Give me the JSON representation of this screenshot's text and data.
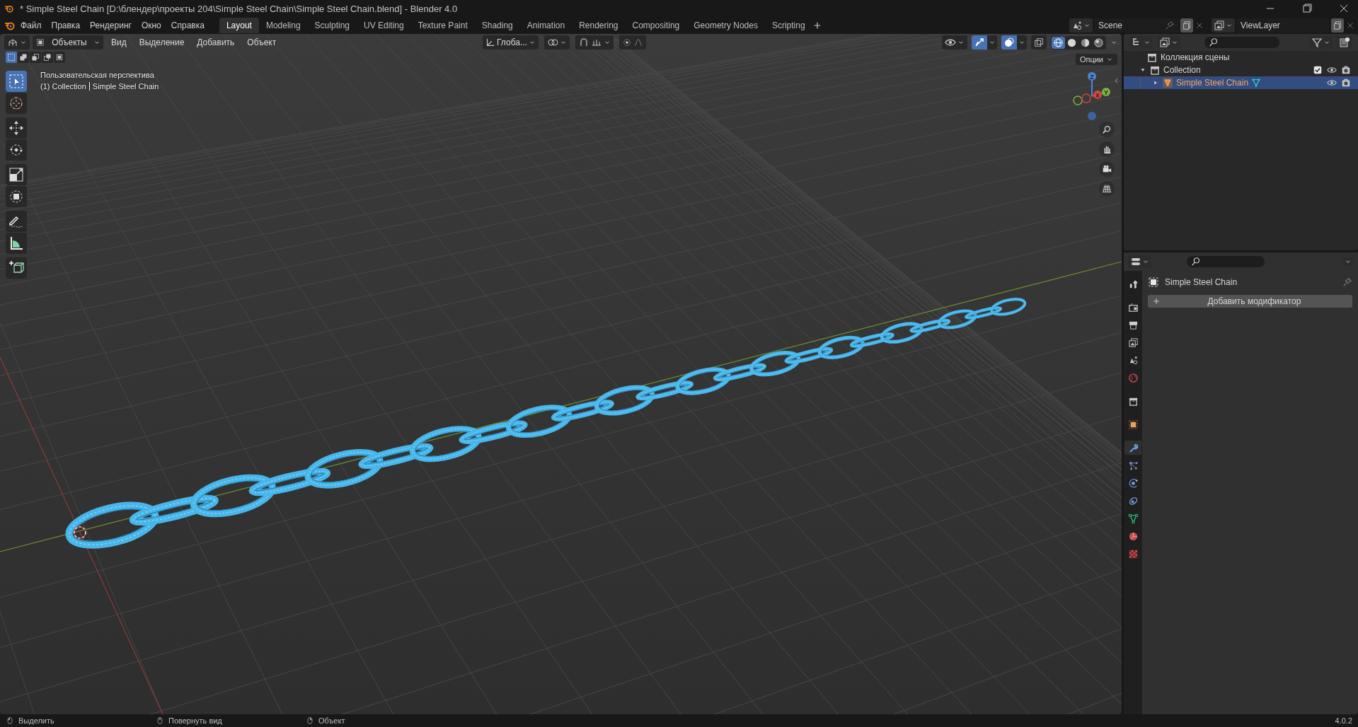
{
  "window": {
    "title": "* Simple Steel Chain [D:\\блендер\\проекты 204\\Simple Steel Chain\\Simple Steel Chain.blend] - Blender 4.0"
  },
  "menu": [
    "Файл",
    "Правка",
    "Рендеринг",
    "Окно",
    "Справка"
  ],
  "workspaces": [
    {
      "label": "Layout",
      "selected": true
    },
    {
      "label": "Modeling",
      "selected": false
    },
    {
      "label": "Sculpting",
      "selected": false
    },
    {
      "label": "UV Editing",
      "selected": false
    },
    {
      "label": "Texture Paint",
      "selected": false
    },
    {
      "label": "Shading",
      "selected": false
    },
    {
      "label": "Animation",
      "selected": false
    },
    {
      "label": "Rendering",
      "selected": false
    },
    {
      "label": "Compositing",
      "selected": false
    },
    {
      "label": "Geometry Nodes",
      "selected": false
    },
    {
      "label": "Scripting",
      "selected": false
    }
  ],
  "scene": {
    "value": "Scene"
  },
  "view_layer": {
    "value": "ViewLayer"
  },
  "viewport": {
    "mode": "Объекты",
    "menus": [
      "Вид",
      "Выделение",
      "Добавить",
      "Объект"
    ],
    "orientation": "Глоба...",
    "options": "Опции",
    "select_modes": [
      {
        "selected": true
      },
      {
        "selected": false
      },
      {
        "selected": false
      },
      {
        "selected": false
      },
      {
        "selected": false
      }
    ],
    "tools": [
      {
        "selected": true
      },
      {
        "selected": false
      },
      {
        "selected": false
      },
      {
        "selected": false
      },
      {
        "selected": false
      },
      {
        "selected": false
      },
      {
        "selected": false
      },
      {
        "selected": false
      },
      {
        "selected": false
      }
    ],
    "shading_modes": [
      {
        "selected": true
      },
      {
        "selected": false
      },
      {
        "selected": false
      },
      {
        "selected": false
      }
    ],
    "overlay_text": [
      "Пользовательская перспектива",
      "(1) Collection",
      "Simple Steel Chain"
    ],
    "gizmo_axes": [
      "X",
      "Y",
      "Z"
    ],
    "gizmos_on": true,
    "overlays_on": true
  },
  "outliner": {
    "items": [
      {
        "label": "Коллекция сцены",
        "kind": "scene_collection",
        "selected": false,
        "children": [
          {
            "label": "Collection",
            "kind": "collection",
            "expanded": true,
            "checked": true,
            "selected": false,
            "children": [
              {
                "label": "Simple Steel Chain",
                "kind": "object",
                "expanded": false,
                "selected": true
              }
            ]
          }
        ]
      }
    ]
  },
  "properties": {
    "object_name": "Simple Steel Chain",
    "add_modifier": "Добавить модификатор",
    "tabs": [
      {
        "selected": false
      },
      {
        "selected": false
      },
      {
        "selected": false
      },
      {
        "selected": false
      },
      {
        "selected": false
      },
      {
        "selected": false
      },
      {
        "selected": false
      },
      {
        "selected": false
      },
      {
        "selected": true
      },
      {
        "selected": false
      },
      {
        "selected": false
      },
      {
        "selected": false
      },
      {
        "selected": false
      },
      {
        "selected": false
      },
      {
        "selected": false
      }
    ]
  },
  "status_bar": {
    "hints": [
      "Выделить",
      "Повернуть вид",
      "Объект"
    ],
    "version": "4.0.2"
  }
}
